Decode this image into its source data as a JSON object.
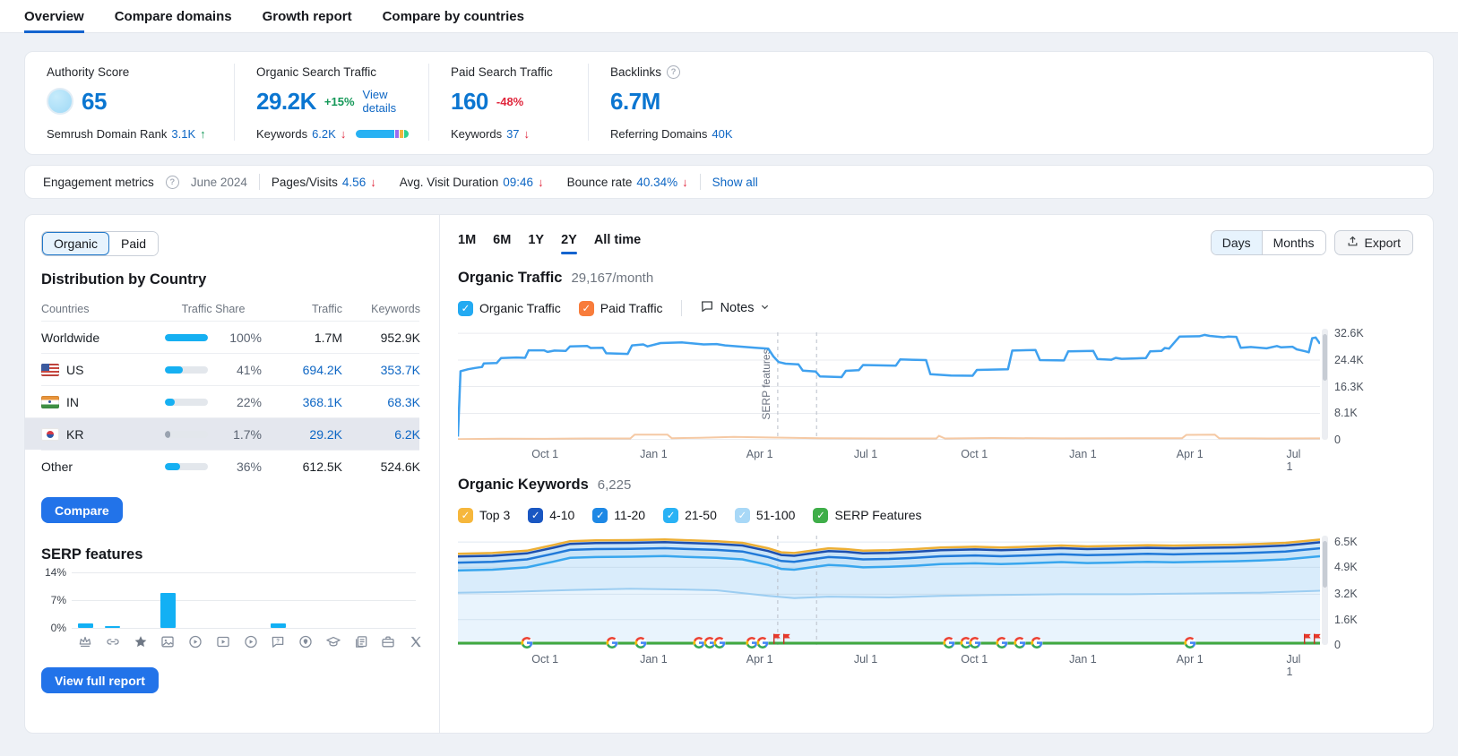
{
  "nav": {
    "tabs": [
      {
        "label": "Overview",
        "active": true
      },
      {
        "label": "Compare domains",
        "active": false
      },
      {
        "label": "Growth report",
        "active": false
      },
      {
        "label": "Compare by countries",
        "active": false
      }
    ]
  },
  "summary": {
    "authority": {
      "title": "Authority Score",
      "score": "65",
      "sub_label": "Semrush Domain Rank",
      "sub_value": "3.1K",
      "sub_trend": "up"
    },
    "organic": {
      "title": "Organic Search Traffic",
      "value": "29.2K",
      "change": "+15%",
      "details_link": "View details",
      "keywords_label": "Keywords",
      "keywords_value": "6.2K",
      "bar_segments": [
        {
          "color": "#27b1f3",
          "width": 76
        },
        {
          "color": "#9a6cf0",
          "width": 8
        },
        {
          "color": "#f3b53f",
          "width": 7
        },
        {
          "color": "#2fd291",
          "width": 9
        }
      ]
    },
    "paid": {
      "title": "Paid Search Traffic",
      "value": "160",
      "change": "-48%",
      "keywords_label": "Keywords",
      "keywords_value": "37"
    },
    "backlinks": {
      "title": "Backlinks",
      "value": "6.7M",
      "sub_label": "Referring Domains",
      "sub_value": "40K"
    }
  },
  "engagement": {
    "title": "Engagement metrics",
    "date": "June 2024",
    "metrics": [
      {
        "label": "Pages/Visits",
        "value": "4.56",
        "trend": "down"
      },
      {
        "label": "Avg. Visit Duration",
        "value": "09:46",
        "trend": "down"
      },
      {
        "label": "Bounce rate",
        "value": "40.34%",
        "trend": "down"
      }
    ],
    "show_all": "Show all"
  },
  "sidebar": {
    "toggle": {
      "organic": "Organic",
      "paid": "Paid",
      "active": "Organic"
    },
    "country_section": {
      "title": "Distribution by Country",
      "headers": [
        "Countries",
        "Traffic Share",
        "Traffic",
        "Keywords"
      ],
      "rows": [
        {
          "country": "Worldwide",
          "flag": "",
          "share": "100%",
          "share_pct": 100,
          "traffic": "1.7M",
          "keywords": "952.9K",
          "link": false,
          "selected": false,
          "bar_color": "#16b0f2"
        },
        {
          "country": "US",
          "flag": "us",
          "share": "41%",
          "share_pct": 41,
          "traffic": "694.2K",
          "keywords": "353.7K",
          "link": true,
          "selected": false,
          "bar_color": "#16b0f2"
        },
        {
          "country": "IN",
          "flag": "in",
          "share": "22%",
          "share_pct": 22,
          "traffic": "368.1K",
          "keywords": "68.3K",
          "link": true,
          "selected": false,
          "bar_color": "#16b0f2"
        },
        {
          "country": "KR",
          "flag": "kr",
          "share": "1.7%",
          "share_pct": 12,
          "traffic": "29.2K",
          "keywords": "6.2K",
          "link": true,
          "selected": true,
          "bar_color": "#9aa3b0"
        },
        {
          "country": "Other",
          "flag": "",
          "share": "36%",
          "share_pct": 36,
          "traffic": "612.5K",
          "keywords": "524.6K",
          "link": false,
          "selected": false,
          "bar_color": "#16b0f2"
        }
      ]
    },
    "compare_button": "Compare",
    "serp_title": "SERP features",
    "view_full_report": "View full report"
  },
  "main": {
    "range_tabs": [
      {
        "label": "1M",
        "active": false
      },
      {
        "label": "6M",
        "active": false
      },
      {
        "label": "1Y",
        "active": false
      },
      {
        "label": "2Y",
        "active": true
      },
      {
        "label": "All time",
        "active": false
      }
    ],
    "granularity": [
      {
        "label": "Days",
        "active": true
      },
      {
        "label": "Months",
        "active": false
      }
    ],
    "export_label": "Export",
    "traffic": {
      "title": "Organic Traffic",
      "subtitle": "29,167/month",
      "legend": [
        {
          "label": "Organic Traffic",
          "color": "#23aaf2",
          "checked": true
        },
        {
          "label": "Paid Traffic",
          "color": "#f87c3b",
          "checked": true
        }
      ],
      "notes_label": "Notes"
    },
    "keywords": {
      "title": "Organic Keywords",
      "subtitle": "6,225",
      "legend": [
        {
          "label": "Top 3",
          "color": "#f6b73c",
          "checked": true
        },
        {
          "label": "4-10",
          "color": "#1a57c2",
          "checked": true
        },
        {
          "label": "11-20",
          "color": "#1e88e5",
          "checked": true
        },
        {
          "label": "21-50",
          "color": "#29b2f5",
          "checked": true
        },
        {
          "label": "51-100",
          "color": "#a8d8f7",
          "checked": true
        },
        {
          "label": "SERP Features",
          "color": "#3fae49",
          "checked": true
        }
      ]
    }
  },
  "chart_data": [
    {
      "type": "line",
      "title": "Organic Traffic",
      "unit": "visits",
      "ylim": [
        0,
        34
      ],
      "y_ticks": [
        {
          "label": "32.6K",
          "value": 32.6
        },
        {
          "label": "24.4K",
          "value": 24.4
        },
        {
          "label": "16.3K",
          "value": 16.3
        },
        {
          "label": "8.1K",
          "value": 8.1
        },
        {
          "label": "0",
          "value": 0
        }
      ],
      "x_ticks": [
        {
          "label": "Oct 1",
          "frac": 0.101
        },
        {
          "label": "Jan 1",
          "frac": 0.227
        },
        {
          "label": "Apr 1",
          "frac": 0.35
        },
        {
          "label": "Jul 1",
          "frac": 0.473
        },
        {
          "label": "Oct 1",
          "frac": 0.599
        },
        {
          "label": "Jan 1",
          "frac": 0.725
        },
        {
          "label": "Apr 1",
          "frac": 0.849
        },
        {
          "label": "Jul 1",
          "frac": 0.974
        }
      ],
      "dashed_x": [
        0.371,
        0.416
      ],
      "annotation": "SERP features",
      "series": [
        {
          "name": "Organic Traffic",
          "color": "#3fa1ef",
          "points": [
            [
              0,
              1
            ],
            [
              0.003,
              21
            ],
            [
              0.012,
              21.6
            ],
            [
              0.02,
              22
            ],
            [
              0.028,
              22.3
            ],
            [
              0.03,
              23.4
            ],
            [
              0.045,
              23.5
            ],
            [
              0.05,
              25
            ],
            [
              0.068,
              25.2
            ],
            [
              0.078,
              25.1
            ],
            [
              0.082,
              27.4
            ],
            [
              0.1,
              27.4
            ],
            [
              0.104,
              26.9
            ],
            [
              0.112,
              27.3
            ],
            [
              0.125,
              27.2
            ],
            [
              0.13,
              28.6
            ],
            [
              0.15,
              28.7
            ],
            [
              0.154,
              28.1
            ],
            [
              0.168,
              28.2
            ],
            [
              0.172,
              26.5
            ],
            [
              0.197,
              26.3
            ],
            [
              0.202,
              28.9
            ],
            [
              0.215,
              29.2
            ],
            [
              0.22,
              28.6
            ],
            [
              0.235,
              29.6
            ],
            [
              0.26,
              29.8
            ],
            [
              0.285,
              29.2
            ],
            [
              0.3,
              29.3
            ],
            [
              0.31,
              28.9
            ],
            [
              0.33,
              28.5
            ],
            [
              0.345,
              28.2
            ],
            [
              0.36,
              27.9
            ],
            [
              0.366,
              25.5
            ],
            [
              0.372,
              23.8
            ],
            [
              0.38,
              23.3
            ],
            [
              0.395,
              23.1
            ],
            [
              0.4,
              21.2
            ],
            [
              0.415,
              20.9
            ],
            [
              0.42,
              19.4
            ],
            [
              0.445,
              19.2
            ],
            [
              0.45,
              21.1
            ],
            [
              0.465,
              21.3
            ],
            [
              0.47,
              22.9
            ],
            [
              0.508,
              22.7
            ],
            [
              0.513,
              24.6
            ],
            [
              0.543,
              24.4
            ],
            [
              0.548,
              20.1
            ],
            [
              0.572,
              19.7
            ],
            [
              0.597,
              19.6
            ],
            [
              0.602,
              21.4
            ],
            [
              0.638,
              21.6
            ],
            [
              0.643,
              27.3
            ],
            [
              0.67,
              27.5
            ],
            [
              0.675,
              24.4
            ],
            [
              0.703,
              24.3
            ],
            [
              0.708,
              27.1
            ],
            [
              0.737,
              27.2
            ],
            [
              0.742,
              24.7
            ],
            [
              0.758,
              24.5
            ],
            [
              0.763,
              25.1
            ],
            [
              0.77,
              24.8
            ],
            [
              0.798,
              25
            ],
            [
              0.803,
              27.1
            ],
            [
              0.816,
              27.2
            ],
            [
              0.82,
              28.1
            ],
            [
              0.825,
              27.9
            ],
            [
              0.837,
              31.6
            ],
            [
              0.86,
              31.7
            ],
            [
              0.866,
              32.1
            ],
            [
              0.872,
              31.8
            ],
            [
              0.888,
              31.4
            ],
            [
              0.893,
              31.6
            ],
            [
              0.903,
              31.5
            ],
            [
              0.908,
              28.2
            ],
            [
              0.92,
              28.4
            ],
            [
              0.938,
              28
            ],
            [
              0.95,
              28.7
            ],
            [
              0.955,
              28.3
            ],
            [
              0.968,
              28.5
            ],
            [
              0.973,
              27.7
            ],
            [
              0.983,
              27.1
            ],
            [
              0.987,
              26.8
            ],
            [
              0.991,
              31.1
            ],
            [
              0.995,
              31.3
            ],
            [
              1,
              29.4
            ]
          ]
        },
        {
          "name": "Paid Traffic",
          "color": "#f5c9a4",
          "points": [
            [
              0,
              0.2
            ],
            [
              0.05,
              0.35
            ],
            [
              0.1,
              0.3
            ],
            [
              0.15,
              0.4
            ],
            [
              0.2,
              0.4
            ],
            [
              0.205,
              1.6
            ],
            [
              0.243,
              1.6
            ],
            [
              0.248,
              0.5
            ],
            [
              0.28,
              0.6
            ],
            [
              0.32,
              0.9
            ],
            [
              0.36,
              0.7
            ],
            [
              0.42,
              0.5
            ],
            [
              0.5,
              0.4
            ],
            [
              0.555,
              0.4
            ],
            [
              0.558,
              1.2
            ],
            [
              0.565,
              0.4
            ],
            [
              0.62,
              0.55
            ],
            [
              0.7,
              0.45
            ],
            [
              0.78,
              0.5
            ],
            [
              0.84,
              0.5
            ],
            [
              0.845,
              1.5
            ],
            [
              0.878,
              1.6
            ],
            [
              0.883,
              0.5
            ],
            [
              0.94,
              0.4
            ],
            [
              1,
              0.45
            ]
          ]
        }
      ]
    },
    {
      "type": "stacked-area",
      "title": "Organic Keywords",
      "ylim": [
        0,
        6.9
      ],
      "y_ticks": [
        {
          "label": "6.5K",
          "value": 6.5
        },
        {
          "label": "4.9K",
          "value": 4.9
        },
        {
          "label": "3.2K",
          "value": 3.2
        },
        {
          "label": "1.6K",
          "value": 1.6
        },
        {
          "label": "0",
          "value": 0
        }
      ],
      "x_ticks": [
        {
          "label": "Oct 1",
          "frac": 0.101
        },
        {
          "label": "Jan 1",
          "frac": 0.227
        },
        {
          "label": "Apr 1",
          "frac": 0.35
        },
        {
          "label": "Jul 1",
          "frac": 0.473
        },
        {
          "label": "Oct 1",
          "frac": 0.599
        },
        {
          "label": "Jan 1",
          "frac": 0.725
        },
        {
          "label": "Apr 1",
          "frac": 0.849
        },
        {
          "label": "Jul 1",
          "frac": 0.974
        }
      ],
      "dashed_x": [
        0.371,
        0.416
      ],
      "total_points": [
        [
          0,
          5.75
        ],
        [
          0.04,
          5.8
        ],
        [
          0.08,
          5.95
        ],
        [
          0.11,
          6.3
        ],
        [
          0.13,
          6.55
        ],
        [
          0.16,
          6.6
        ],
        [
          0.2,
          6.62
        ],
        [
          0.24,
          6.66
        ],
        [
          0.27,
          6.6
        ],
        [
          0.3,
          6.55
        ],
        [
          0.33,
          6.45
        ],
        [
          0.36,
          6.1
        ],
        [
          0.375,
          5.85
        ],
        [
          0.39,
          5.8
        ],
        [
          0.41,
          5.95
        ],
        [
          0.43,
          6.1
        ],
        [
          0.45,
          6.05
        ],
        [
          0.47,
          5.95
        ],
        [
          0.5,
          5.98
        ],
        [
          0.53,
          6.05
        ],
        [
          0.56,
          6.15
        ],
        [
          0.6,
          6.2
        ],
        [
          0.63,
          6.15
        ],
        [
          0.66,
          6.2
        ],
        [
          0.7,
          6.28
        ],
        [
          0.73,
          6.22
        ],
        [
          0.76,
          6.25
        ],
        [
          0.8,
          6.3
        ],
        [
          0.83,
          6.27
        ],
        [
          0.86,
          6.3
        ],
        [
          0.9,
          6.33
        ],
        [
          0.93,
          6.38
        ],
        [
          0.96,
          6.45
        ],
        [
          0.98,
          6.55
        ],
        [
          1,
          6.65
        ]
      ],
      "band_offsets": [
        0.17,
        0.55,
        1.05
      ],
      "band_colors": [
        "#edaf35",
        "#1d4fae",
        "#2079d8",
        "#38a6ee"
      ],
      "mid_points": [
        [
          0,
          3.3
        ],
        [
          0.06,
          3.35
        ],
        [
          0.12,
          3.45
        ],
        [
          0.2,
          3.55
        ],
        [
          0.26,
          3.5
        ],
        [
          0.3,
          3.45
        ],
        [
          0.36,
          3.1
        ],
        [
          0.39,
          2.95
        ],
        [
          0.43,
          3.05
        ],
        [
          0.5,
          3.0
        ],
        [
          0.56,
          3.1
        ],
        [
          0.62,
          3.15
        ],
        [
          0.7,
          3.2
        ],
        [
          0.78,
          3.2
        ],
        [
          0.86,
          3.25
        ],
        [
          0.93,
          3.3
        ],
        [
          1,
          3.42
        ]
      ],
      "mid_color": "#9ccdf1",
      "serp_line_color": "#41a83f",
      "google_marker_fracs": [
        0.08,
        0.179,
        0.212,
        0.28,
        0.292,
        0.304,
        0.341,
        0.353,
        0.57,
        0.589,
        0.6,
        0.631,
        0.652,
        0.672,
        0.849
      ],
      "flag_marker_fracs": [
        0.371,
        0.383,
        0.986,
        0.998
      ]
    },
    {
      "type": "bar",
      "title": "SERP features",
      "ymax": 14,
      "y_ticks": [
        "14%",
        "7%",
        "0%"
      ],
      "values": [
        1.2,
        0.4,
        0,
        8.7,
        0,
        0,
        0,
        1.2,
        0,
        0,
        0,
        0,
        0
      ],
      "bar_color": "#12b0f4",
      "icons": [
        "crown",
        "link",
        "star",
        "image",
        "video-circle",
        "video-rect",
        "video-circle",
        "chat-question",
        "location",
        "graduation-cap",
        "documents",
        "briefcase",
        "x-twitter"
      ]
    }
  ]
}
